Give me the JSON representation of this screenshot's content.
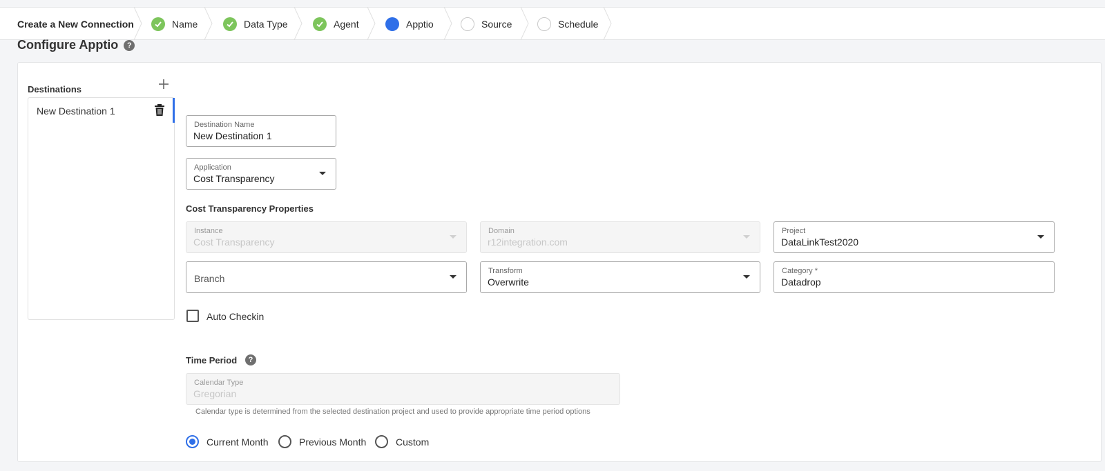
{
  "wizard": {
    "title": "Create a New Connection",
    "steps": [
      {
        "label": "Name",
        "state": "done"
      },
      {
        "label": "Data Type",
        "state": "done"
      },
      {
        "label": "Agent",
        "state": "done"
      },
      {
        "label": "Apptio",
        "state": "active"
      },
      {
        "label": "Source",
        "state": "todo"
      },
      {
        "label": "Schedule",
        "state": "todo"
      }
    ]
  },
  "page": {
    "title": "Configure Apptio",
    "help_glyph": "?"
  },
  "destinations": {
    "label": "Destinations",
    "add_glyph": "+",
    "items": [
      {
        "label": "New Destination 1"
      }
    ]
  },
  "form": {
    "destination_name": {
      "label": "Destination Name",
      "value": "New Destination 1"
    },
    "application": {
      "label": "Application",
      "value": "Cost Transparency"
    },
    "properties_title": "Cost Transparency Properties",
    "instance": {
      "label": "Instance",
      "value": "Cost Transparency"
    },
    "domain": {
      "label": "Domain",
      "value": "r12integration.com"
    },
    "project": {
      "label": "Project",
      "value": "DataLinkTest2020"
    },
    "branch": {
      "placeholder": "Branch"
    },
    "transform": {
      "label": "Transform",
      "value": "Overwrite"
    },
    "category": {
      "label": "Category *",
      "value": "Datadrop"
    },
    "auto_checkin": {
      "label": "Auto Checkin",
      "checked": false
    }
  },
  "time_period": {
    "title": "Time Period",
    "help_glyph": "?",
    "calendar_type": {
      "label": "Calendar Type",
      "value": "Gregorian"
    },
    "hint": "Calendar type is determined from the selected destination project and used to provide appropriate time period options",
    "options": [
      {
        "label": "Current Month",
        "selected": true
      },
      {
        "label": "Previous Month",
        "selected": false
      },
      {
        "label": "Custom",
        "selected": false
      }
    ]
  },
  "colors": {
    "accent": "#2f6fe8",
    "done": "#7dc55c"
  }
}
